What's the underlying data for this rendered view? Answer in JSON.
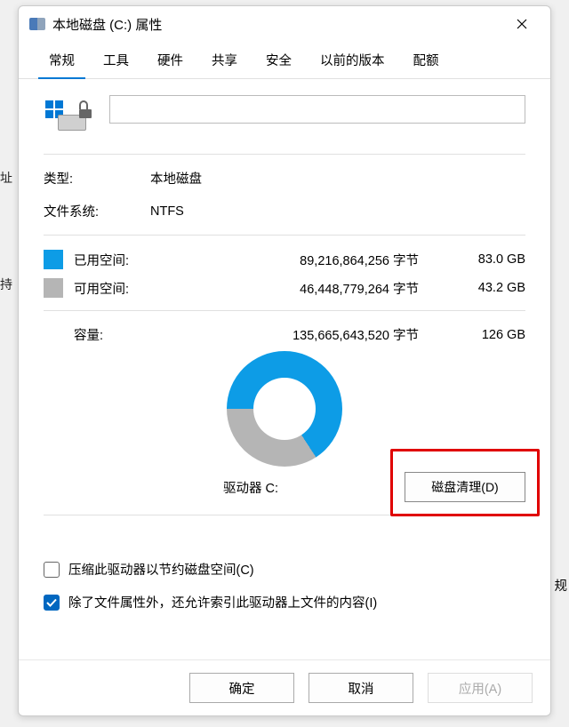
{
  "window": {
    "title": "本地磁盘 (C:) 属性"
  },
  "tabs": [
    {
      "label": "常规",
      "active": true
    },
    {
      "label": "工具",
      "active": false
    },
    {
      "label": "硬件",
      "active": false
    },
    {
      "label": "共享",
      "active": false
    },
    {
      "label": "安全",
      "active": false
    },
    {
      "label": "以前的版本",
      "active": false
    },
    {
      "label": "配额",
      "active": false
    }
  ],
  "drive_name": "",
  "type_row": {
    "label": "类型:",
    "value": "本地磁盘"
  },
  "fs_row": {
    "label": "文件系统:",
    "value": "NTFS"
  },
  "used": {
    "label": "已用空间:",
    "bytes": "89,216,864,256 字节",
    "gb": "83.0 GB",
    "color": "#0d9ce6"
  },
  "free": {
    "label": "可用空间:",
    "bytes": "46,448,779,264 字节",
    "gb": "43.2 GB",
    "color": "#b5b5b5"
  },
  "capacity": {
    "label": "容量:",
    "bytes": "135,665,643,520 字节",
    "gb": "126 GB"
  },
  "drive_label": "驱动器 C:",
  "cleanup_button": "磁盘清理(D)",
  "check_compress": {
    "label": "压缩此驱动器以节约磁盘空间(C)",
    "checked": false
  },
  "check_index": {
    "label": "除了文件属性外，还允许索引此驱动器上文件的内容(I)",
    "checked": true
  },
  "footer": {
    "ok": "确定",
    "cancel": "取消",
    "apply": "应用(A)"
  },
  "chart_data": {
    "type": "pie",
    "title": "驱动器 C:",
    "series": [
      {
        "name": "已用空间",
        "value": 83.0,
        "color": "#0d9ce6"
      },
      {
        "name": "可用空间",
        "value": 43.2,
        "color": "#b5b5b5"
      }
    ],
    "unit": "GB",
    "total": 126
  },
  "bg": {
    "a": "址",
    "b": "持",
    "c": "规"
  }
}
